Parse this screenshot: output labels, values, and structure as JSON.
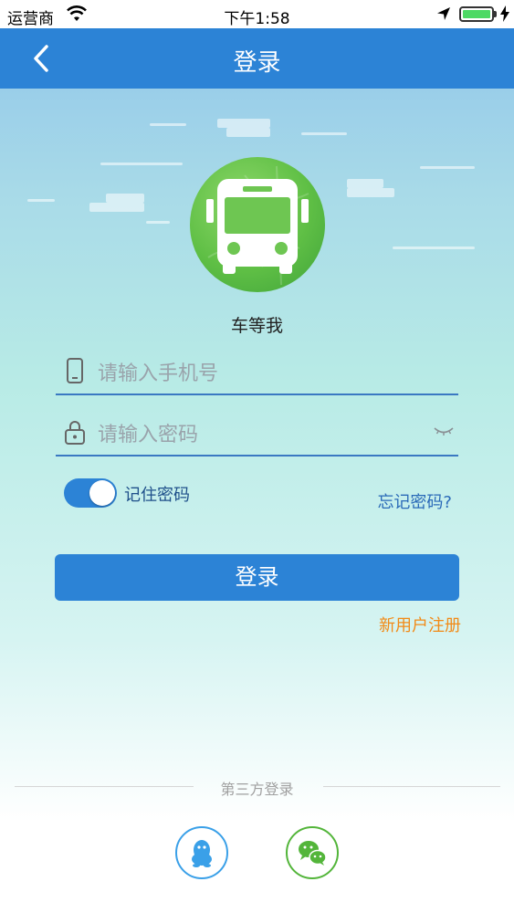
{
  "status_bar": {
    "carrier": "运营商",
    "time": "下午1:58",
    "battery_level": 1.0
  },
  "nav": {
    "title": "登录"
  },
  "app": {
    "name": "车等我"
  },
  "form": {
    "phone_placeholder": "请输入手机号",
    "password_placeholder": "请输入密码",
    "remember_label": "记住密码",
    "remember_on": true,
    "forgot_label": "忘记密码?",
    "login_label": "登录",
    "register_label": "新用户注册"
  },
  "third_party": {
    "label": "第三方登录",
    "providers": [
      "qq-icon",
      "wechat-icon"
    ]
  },
  "colors": {
    "primary": "#2c83d6",
    "accent_orange": "#f28a16",
    "logo_green": "#5fbf45",
    "qq_blue": "#3aa0e8",
    "wechat_green": "#53b53a"
  }
}
